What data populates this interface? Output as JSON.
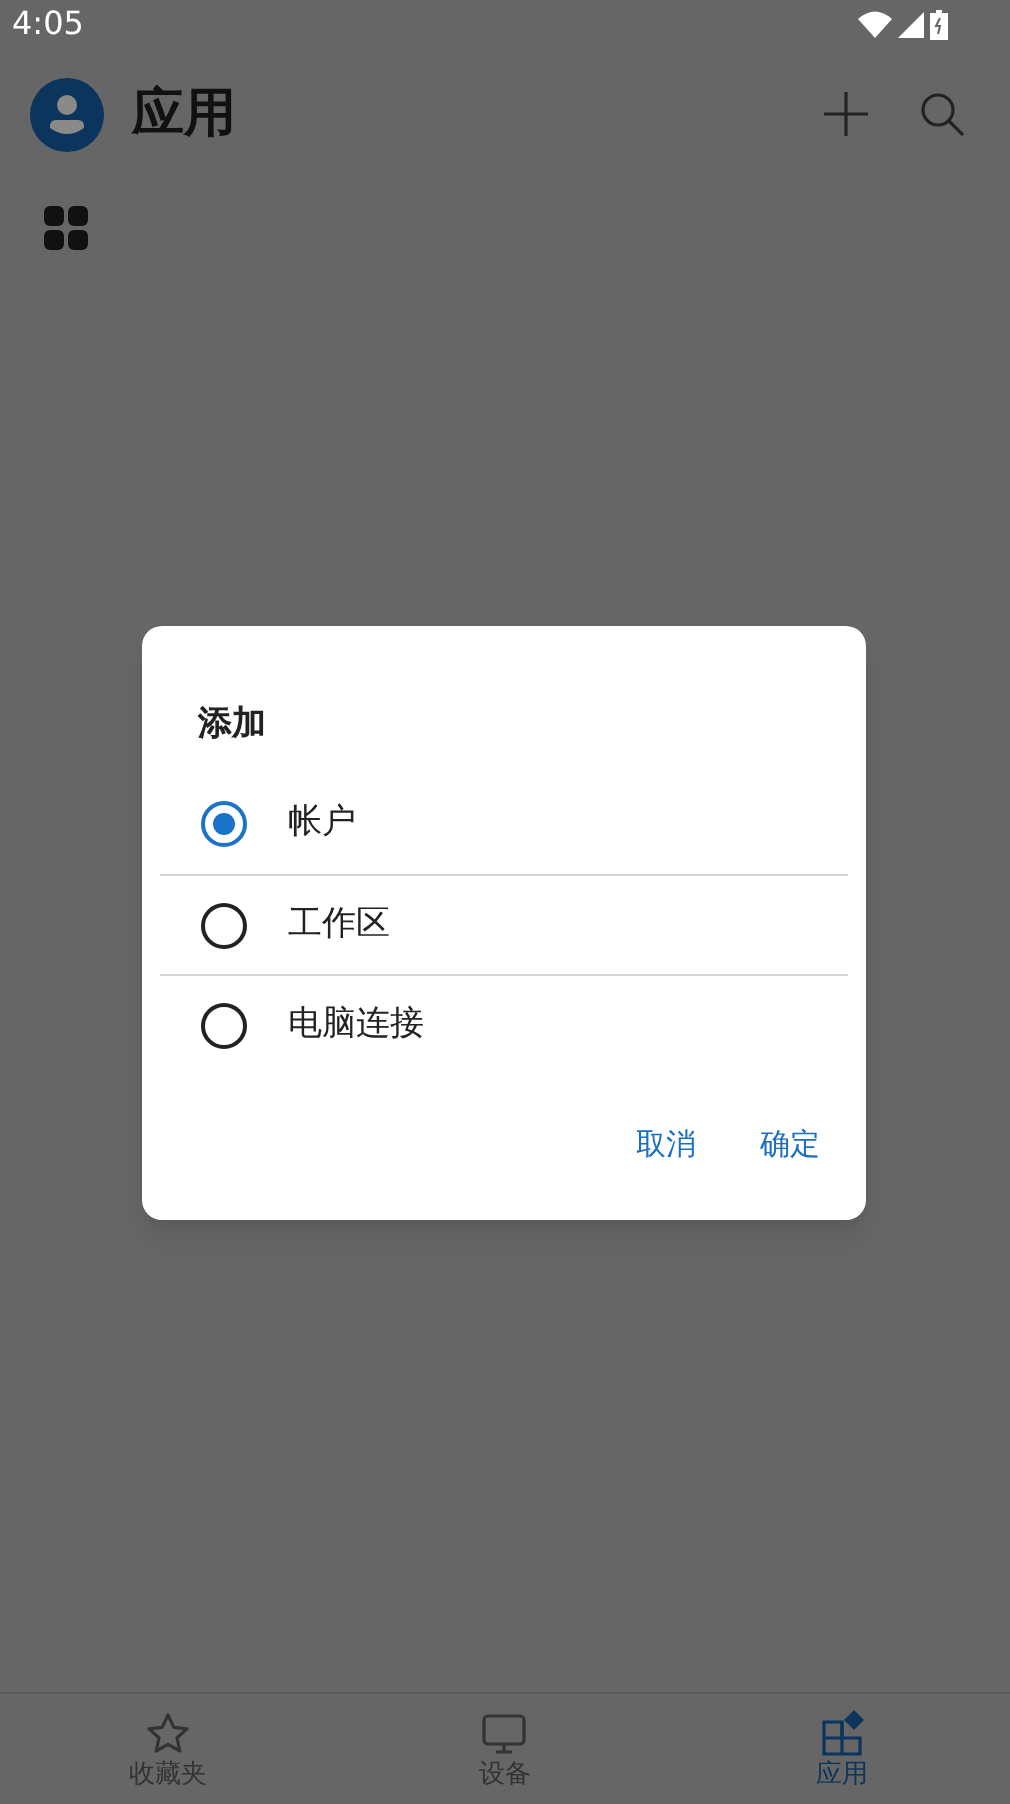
{
  "status_bar": {
    "time": "4:05"
  },
  "header": {
    "title": "应用"
  },
  "dialog": {
    "title": "添加",
    "options": [
      {
        "label": "帐户",
        "selected": true
      },
      {
        "label": "工作区",
        "selected": false
      },
      {
        "label": "电脑连接",
        "selected": false
      }
    ],
    "buttons": [
      "取消",
      "确定"
    ]
  },
  "bottom_nav": [
    {
      "label": "收藏夹",
      "kind": "star",
      "selected": false
    },
    {
      "label": "设备",
      "kind": "monitor",
      "selected": false
    },
    {
      "label": "应用",
      "kind": "apps",
      "selected": true
    }
  ]
}
